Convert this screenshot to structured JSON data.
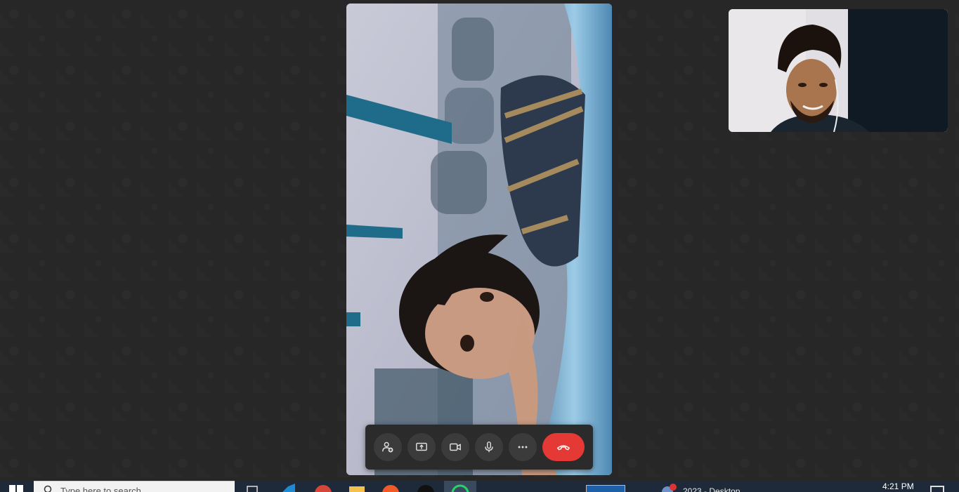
{
  "call": {
    "remote_participant_video": "remote-video",
    "self_video": "self-view"
  },
  "controls": [
    {
      "id": "add-participant",
      "icon": "add-person-icon"
    },
    {
      "id": "share-screen",
      "icon": "screen-share-icon"
    },
    {
      "id": "camera",
      "icon": "video-camera-icon"
    },
    {
      "id": "microphone",
      "icon": "microphone-icon"
    },
    {
      "id": "more",
      "icon": "more-dots-icon"
    },
    {
      "id": "end-call",
      "icon": "end-call-icon",
      "color": "#e53935"
    }
  ],
  "taskbar": {
    "search_placeholder": "Type here to search",
    "time": "4:21 PM",
    "window_label": "2023 - Desktop",
    "badge_count": "1"
  },
  "colors": {
    "background": "#272727",
    "control_bar": "#2b2b2b",
    "control_button": "#3b3b3b",
    "end_call": "#e53935",
    "taskbar": "#1e2a3a"
  }
}
